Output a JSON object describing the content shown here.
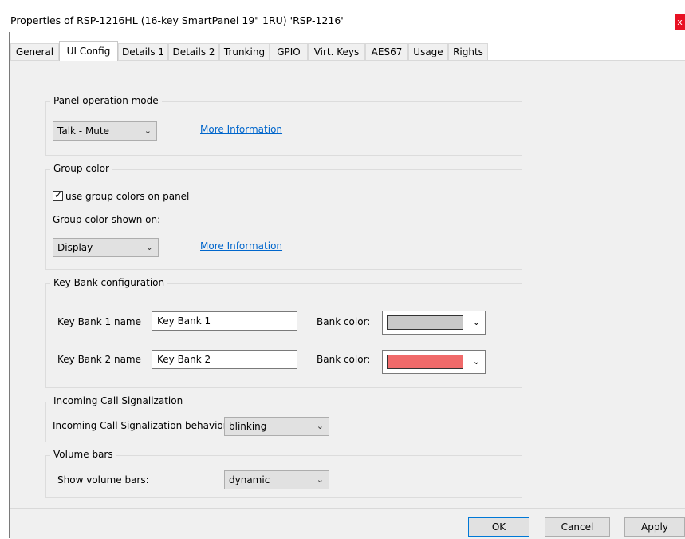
{
  "window": {
    "title": "Properties of RSP-1216HL (16-key SmartPanel 19\" 1RU) 'RSP-1216'",
    "close_glyph": "x"
  },
  "tabs": [
    {
      "label": "General"
    },
    {
      "label": "UI Config",
      "active": true
    },
    {
      "label": "Details 1"
    },
    {
      "label": "Details 2"
    },
    {
      "label": "Trunking"
    },
    {
      "label": "GPIO"
    },
    {
      "label": "Virt. Keys"
    },
    {
      "label": "AES67"
    },
    {
      "label": "Usage"
    },
    {
      "label": "Rights"
    }
  ],
  "panel_mode": {
    "legend": "Panel operation mode",
    "selected": "Talk - Mute",
    "more_info": "More Information"
  },
  "group_color": {
    "legend": "Group color",
    "use_group_colors_label": "use group colors on panel",
    "use_group_colors_checked": true,
    "shown_on_label": "Group color shown on:",
    "shown_on_selected": "Display",
    "more_info": "More Information"
  },
  "key_bank": {
    "legend": "Key Bank configuration",
    "bank1_label": "Key Bank 1 name",
    "bank1_value": "Key Bank 1",
    "bank1_color_label": "Bank color:",
    "bank1_color": "#c8c8c8",
    "bank2_label": "Key Bank 2 name",
    "bank2_value": "Key Bank 2",
    "bank2_color_label": "Bank color:",
    "bank2_color": "#f06a6a"
  },
  "incoming_call": {
    "legend": "Incoming Call Signalization",
    "behavior_label": "Incoming Call Signalization behavior:",
    "behavior_selected": "blinking"
  },
  "volume_bars": {
    "legend": "Volume bars",
    "show_label": "Show volume bars:",
    "show_selected": "dynamic"
  },
  "footer": {
    "ok_label": "OK",
    "cancel_label": "Cancel",
    "apply_label": "Apply"
  },
  "icons": {
    "chevron": "chevron-down-icon",
    "check": "checkmark-icon"
  }
}
